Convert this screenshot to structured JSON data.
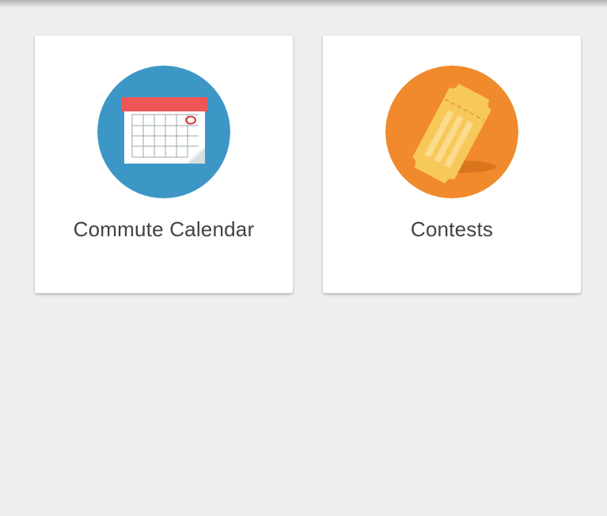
{
  "tiles": [
    {
      "label": "Commute Calendar",
      "icon": "calendar-icon",
      "color": "#3d97c6"
    },
    {
      "label": "Contests",
      "icon": "ticket-icon",
      "color": "#f08a2c"
    }
  ],
  "colors": {
    "background": "#eeeeee",
    "card": "#ffffff",
    "label_text": "#424242",
    "calendar_header": "#ef5656",
    "ticket": "#f7c85a"
  }
}
